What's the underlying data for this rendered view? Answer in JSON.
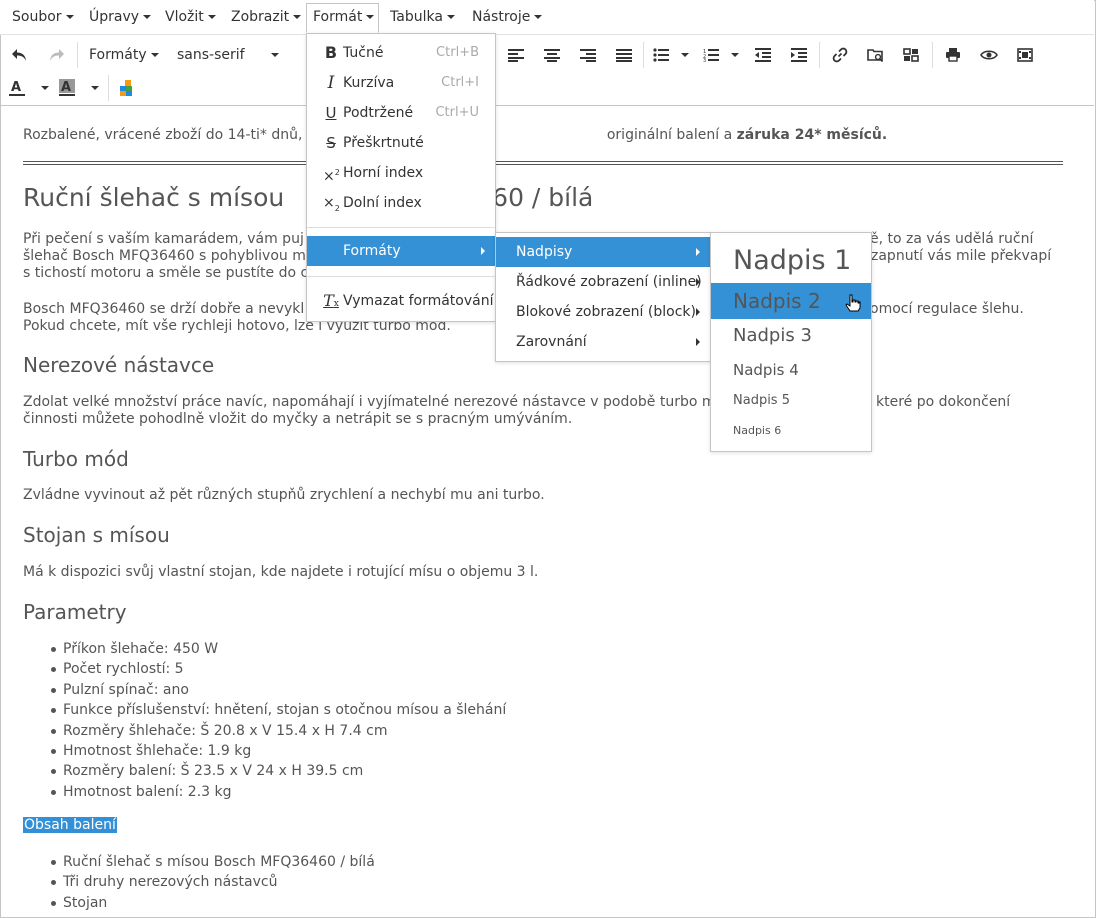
{
  "menubar": {
    "items": [
      "Soubor",
      "Úpravy",
      "Vložit",
      "Zobrazit",
      "Formát",
      "Tabulka",
      "Nástroje"
    ]
  },
  "toolbar": {
    "formats_label": "Formáty",
    "font_family": "sans-serif"
  },
  "content": {
    "intro_a": "Rozbalené, vrácené zboží do 14-ti* dnů, ",
    "intro_b": "originální balení a ",
    "intro_bold": "záruka 24* měsíců.",
    "title_a": "Ruční šlehač s mísou ",
    "title_b": "60 / bílá",
    "p1_l1a": "Při pečení s vaším kamarádem, vám puj",
    "p1_l1b": "ě, to za vás udělá ruční",
    "p1_l2a": "šlehač Bosch MFQ36460 s pohyblivou m",
    "p1_l2b": "zapnutí vás mile překvapí",
    "p1_l3": "s tichostí motoru a směle se pustíte do c",
    "p2_l1a": "Bosch MFQ36460 se drží dobře a nevykl",
    "p2_l1b": "omocí regulace šlehu.",
    "p2_l2": "Pokud chcete, mít vše rychleji hotovo, lze i využít turbo mód.",
    "h_nerez": "Nerezové nástavce",
    "p3_l1a": "Zdolat velké množství práce navíc, napomáhají i vyjímatelné nerezové nástavce v podobě turbo m",
    "p3_l1b": "které po dokončení",
    "p3_l2": "činnosti můžete pohodlně vložit do myčky a netrápit se s pracným umýváním.",
    "h_turbo": "Turbo mód",
    "p4": "Zvládne vyvinout až pět různých stupňů zrychlení a nechybí mu ani turbo.",
    "h_stojan": "Stojan s mísou",
    "p5": "Má k dispozici svůj vlastní stojan, kde najdete i rotující mísu o objemu 3 l.",
    "h_param": "Parametry",
    "params": [
      "Příkon šlehače: 450 W",
      "Počet rychlostí: 5",
      "Pulzní spínač: ano",
      "Funkce příslušenství: hnětení, stojan s otočnou mísou a šlehání",
      "Rozměry šhlehače: Š 20.8 x V 15.4 x H 7.4 cm",
      "Hmotnost šhlehače: 1.9 kg",
      "Rozměry balení: Š 23.5 x V 24 x H 39.5 cm",
      "Hmotnost balení: 2.3 kg"
    ],
    "obsah": "Obsah balení",
    "obsah_items": [
      "Ruční šlehač s mísou Bosch MFQ36460 / bílá",
      "Tři druhy nerezových nástavců",
      "Stojan"
    ]
  },
  "format_menu": {
    "items": [
      {
        "label": "Tučné",
        "shortcut": "Ctrl+B"
      },
      {
        "label": "Kurzíva",
        "shortcut": "Ctrl+I"
      },
      {
        "label": "Podtržené",
        "shortcut": "Ctrl+U"
      },
      {
        "label": "Přeškrtnuté",
        "shortcut": ""
      },
      {
        "label": "Horní index",
        "shortcut": ""
      },
      {
        "label": "Dolní index",
        "shortcut": ""
      }
    ],
    "formats": "Formáty",
    "clear": "Vymazat formátování"
  },
  "formats_menu": {
    "items": [
      "Nadpisy",
      "Řádkové zobrazení (inline)",
      "Blokové zobrazení (block)",
      "Zarovnání"
    ]
  },
  "headings_menu": {
    "items": [
      "Nadpis 1",
      "Nadpis 2",
      "Nadpis 3",
      "Nadpis 4",
      "Nadpis 5",
      "Nadpis 6"
    ]
  },
  "colors": {
    "accent": "#3491d5",
    "selection": "#3390d6"
  }
}
